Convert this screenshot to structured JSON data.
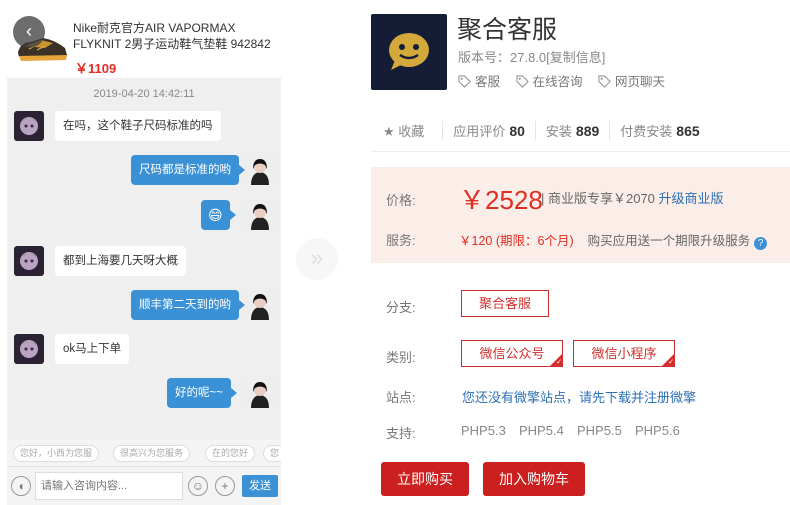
{
  "chat": {
    "product": {
      "title": "Nike耐克官方AIR VAPORMAX FLYKNIT 2男子运动鞋气垫鞋 942842",
      "price": "￥1109"
    },
    "timestamp": "2019-04-20 14:42:11",
    "messages": [
      {
        "side": "in",
        "text": "在吗，这个鞋子尺码标准的吗"
      },
      {
        "side": "out",
        "text": "尺码都是标准的哟"
      },
      {
        "side": "out",
        "text": "😄"
      },
      {
        "side": "in",
        "text": "都到上海要几天呀大概"
      },
      {
        "side": "out",
        "text": "顺丰第二天到的哟"
      },
      {
        "side": "in",
        "text": "ok马上下单"
      },
      {
        "side": "out",
        "text": "好的呢~~"
      }
    ],
    "quick_replies": [
      "您好，小西为您服",
      "很高兴为您服务",
      "在的您好",
      "您"
    ],
    "input_placeholder": "请输入咨询内容...",
    "send_label": "发送"
  },
  "app": {
    "title": "聚合客服",
    "version": "版本号：27.8.0[复制信息]",
    "tags": [
      "客服",
      "在线咨询",
      "网页聊天"
    ],
    "favorite_label": "收藏",
    "stats": [
      {
        "label": "应用评价",
        "value": "80"
      },
      {
        "label": "安装",
        "value": "889"
      },
      {
        "label": "付费安装",
        "value": "865"
      }
    ]
  },
  "pricing": {
    "price_label": "价格:",
    "price": "￥2528",
    "business_text": "| 商业版专享￥2070",
    "upgrade_link": "升级商业版",
    "service_label": "服务:",
    "service_price": "￥120 (期限：6个月)",
    "service_note": "购买应用送一个期限升级服务"
  },
  "options": {
    "branch_label": "分支:",
    "branch": "聚合客服",
    "category_label": "类别:",
    "categories": [
      "微信公众号",
      "微信小程序"
    ],
    "site_label": "站点:",
    "site_text": "您还没有微擎站点，请先下载并注册微擎",
    "support_label": "支持:",
    "support": [
      "PHP5.3",
      "PHP5.4",
      "PHP5.5",
      "PHP5.6"
    ]
  },
  "actions": {
    "buy_label": "立即购买",
    "cart_label": "加入购物车"
  },
  "colors": {
    "accent_red": "#cc1f1f",
    "chat_blue": "#3b91d6",
    "link_blue": "#2e70b7",
    "price_bg": "#fbeee8"
  }
}
